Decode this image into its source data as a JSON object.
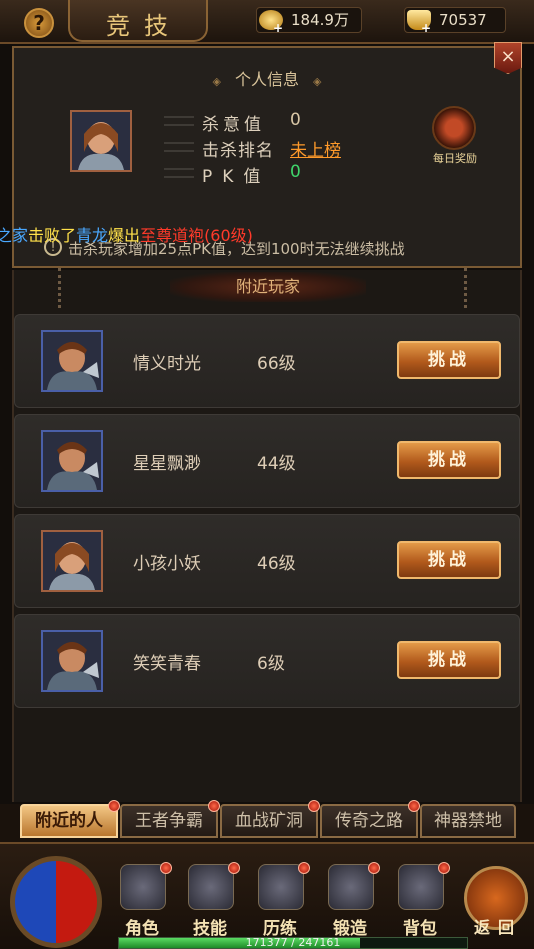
{
  "topbar": {
    "title": "竞技",
    "help_glyph": "?",
    "gold": "184.9万",
    "ingot": "70537",
    "plus": "+"
  },
  "info": {
    "section_title": "个人信息",
    "diamond": "◈",
    "close_glyph": "×",
    "stats": [
      {
        "label": "杀意值",
        "value": "0",
        "color": "#d9c7a6"
      },
      {
        "label": "击杀排名",
        "value": "未上榜",
        "color": "#ff9a2a"
      },
      {
        "label": "PK值",
        "value": "0",
        "color": "#3fd46a"
      }
    ],
    "reward_label": "每日奖励",
    "warning": "击杀玩家增加25点PK值，达到100时无法继续挑战",
    "warning_glyph": "!"
  },
  "broadcast": {
    "parts": [
      {
        "text": "之家",
        "color": "#4aa8ff"
      },
      {
        "text": "击败了",
        "color": "#ffe14a"
      },
      {
        "text": "青龙",
        "color": "#4aa8ff"
      },
      {
        "text": "爆出",
        "color": "#ffe14a"
      },
      {
        "text": "至尊道袍(60级)",
        "color": "#ff3a2a"
      }
    ]
  },
  "nearby": {
    "title": "附近玩家",
    "challenge_label": "挑战",
    "players": [
      {
        "name": "情义时光",
        "level": "66级",
        "gender": "male"
      },
      {
        "name": "星星飘渺",
        "level": "44级",
        "gender": "male"
      },
      {
        "name": "小孩小妖",
        "level": "46级",
        "gender": "female"
      },
      {
        "name": "笑笑青春",
        "level": "6级",
        "gender": "male"
      }
    ]
  },
  "tabs": [
    {
      "label": "附近的人",
      "active": true
    },
    {
      "label": "王者争霸",
      "active": false
    },
    {
      "label": "血战矿洞",
      "active": false
    },
    {
      "label": "传奇之路",
      "active": false
    },
    {
      "label": "神器禁地",
      "active": false
    }
  ],
  "bottom_menu": [
    {
      "label": "角色",
      "icon": "character-icon"
    },
    {
      "label": "技能",
      "icon": "skill-icon"
    },
    {
      "label": "历练",
      "icon": "training-icon"
    },
    {
      "label": "锻造",
      "icon": "forge-icon"
    },
    {
      "label": "背包",
      "icon": "bag-icon"
    }
  ],
  "return_label": "返回",
  "exp": {
    "current": 171377,
    "max": 247161,
    "text": "171377 / 247161"
  }
}
